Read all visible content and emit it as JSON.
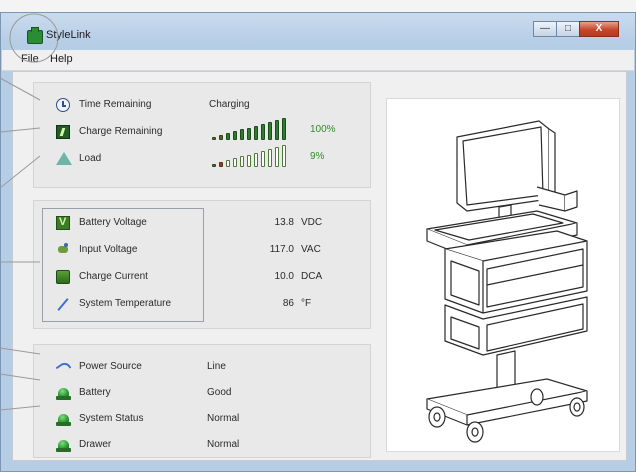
{
  "window": {
    "title": "StyleLink",
    "controls": {
      "minimize": "—",
      "maximize": "□",
      "close": "X"
    }
  },
  "menu": {
    "items": [
      "File",
      "Help"
    ]
  },
  "status_panel": {
    "rows": [
      {
        "label": "Time Remaining",
        "value": "Charging",
        "icon": "clock-icon"
      },
      {
        "label": "Charge Remaining",
        "percent": "100%",
        "icon": "charge-icon",
        "level": 1.0
      },
      {
        "label": "Load",
        "percent": "9%",
        "icon": "load-icon",
        "level": 0.09
      }
    ]
  },
  "measurements_panel": {
    "rows": [
      {
        "label": "Battery Voltage",
        "value": "13.8",
        "unit": "VDC",
        "icon": "battery-voltage-icon"
      },
      {
        "label": "Input Voltage",
        "value": "117.0",
        "unit": "VAC",
        "icon": "input-voltage-icon"
      },
      {
        "label": "Charge Current",
        "value": "10.0",
        "unit": "DCA",
        "icon": "charge-current-icon"
      },
      {
        "label": "System Temperature",
        "value": "86",
        "unit": "°F",
        "icon": "temperature-icon"
      }
    ]
  },
  "system_panel": {
    "rows": [
      {
        "label": "Power Source",
        "value": "Line",
        "icon": "power-source-icon"
      },
      {
        "label": "Battery",
        "value": "Good",
        "icon": "status-light-icon"
      },
      {
        "label": "System Status",
        "value": "Normal",
        "icon": "status-light-icon"
      },
      {
        "label": "Drawer",
        "value": "Normal",
        "icon": "status-light-icon"
      }
    ]
  },
  "colors": {
    "bar_filled": "#2e7d2e",
    "bar_dim": "#8a4b2a",
    "bar_empty": "#ffffff",
    "percent_text": "#2e8b2e",
    "status_light": "#1f8f2a"
  },
  "cart_image": {
    "icon": "medical-cart-illustration"
  }
}
